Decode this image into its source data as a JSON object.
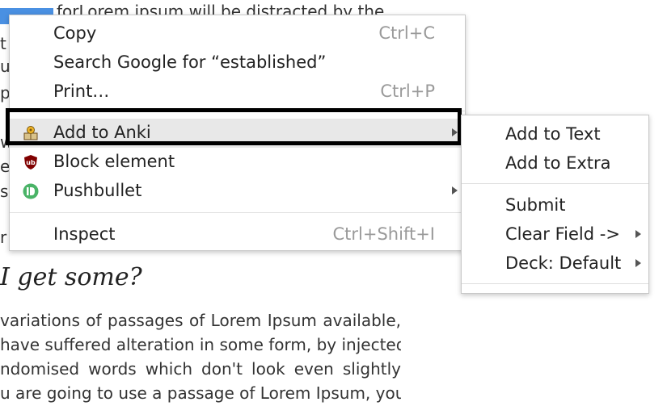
{
  "background": {
    "top_line": "forLorem ipsum will be distracted by the",
    "left_fragments": [
      "t",
      "u",
      "p",
      "w",
      "e",
      "s",
      "r"
    ],
    "heading": "I get some?",
    "paragraph_lines": [
      "variations of passages of Lorem Ipsum available,",
      "have suffered alteration in some form, by injected",
      "ndomised words which don't look even slightly",
      "u are going to use a passage of Lorem Ipsum, you"
    ]
  },
  "context_menu": {
    "copy": {
      "label": "Copy",
      "shortcut": "Ctrl+C"
    },
    "search": {
      "label": "Search Google for “established”"
    },
    "print": {
      "label": "Print…",
      "shortcut": "Ctrl+P"
    },
    "anki": {
      "label": "Add to Anki",
      "icon": "anki-icon"
    },
    "block": {
      "label": "Block element",
      "icon": "ublock-icon"
    },
    "pushbullet": {
      "label": "Pushbullet",
      "icon": "pushbullet-icon"
    },
    "inspect": {
      "label": "Inspect",
      "shortcut": "Ctrl+Shift+I"
    }
  },
  "submenu": {
    "add_text": "Add to Text",
    "add_extra": "Add to Extra",
    "submit": "Submit",
    "clear_field": "Clear Field ->",
    "deck": "Deck: Default"
  },
  "colors": {
    "selection": "#4a90e2",
    "highlight": "#e8e8e8",
    "ublock": "#800000",
    "pushbullet": "#4ab367"
  }
}
